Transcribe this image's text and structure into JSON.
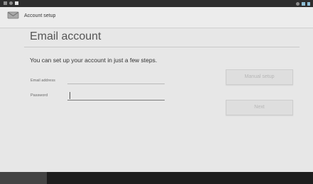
{
  "action_bar": {
    "title": "Account setup"
  },
  "page": {
    "title": "Email account",
    "intro": "You can set up your account in just a few steps."
  },
  "form": {
    "email_label": "Email address",
    "email_value": "",
    "password_label": "Password",
    "password_value": ""
  },
  "buttons": {
    "manual_setup": "Manual setup",
    "next": "Next"
  },
  "colors": {
    "background": "#e7e7e7",
    "status_bar": "#2e2e2e",
    "nav_bar": "#1e1e1e",
    "button_text_disabled": "#b7b7b7"
  },
  "icons": {
    "app": "email-app-icon",
    "status": [
      "notification-icon",
      "wifi-icon",
      "battery-icon"
    ]
  }
}
